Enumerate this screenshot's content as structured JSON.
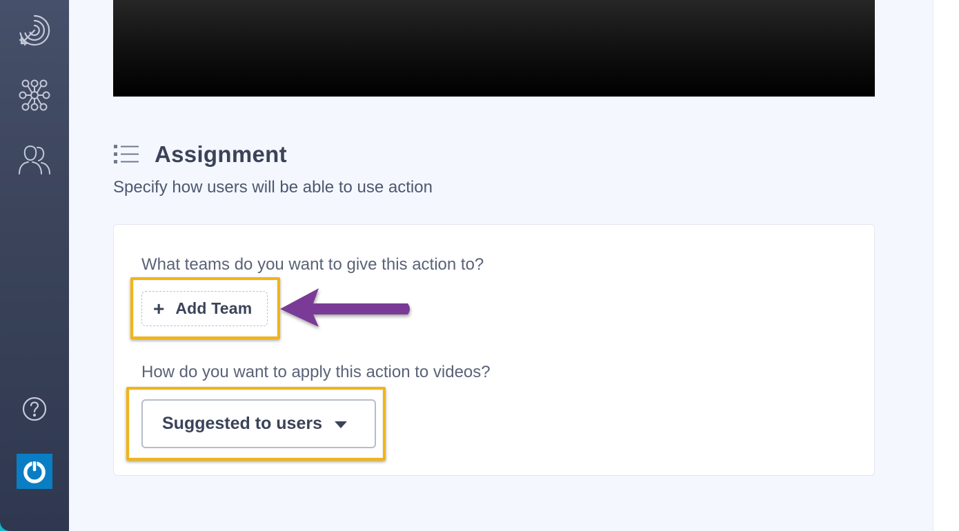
{
  "sidebar": {
    "items": [
      {
        "icon": "target-icon"
      },
      {
        "icon": "network-icon"
      },
      {
        "icon": "users-icon"
      }
    ],
    "help_icon": "help-icon",
    "power_icon": "power-icon"
  },
  "section": {
    "title": "Assignment",
    "subtitle": "Specify how users will be able to use action"
  },
  "card": {
    "teams_question": "What teams do you want to give this action to?",
    "add_team_label": "Add Team",
    "add_team_icon": "+",
    "videos_question": "How do you want to apply this action to videos?",
    "apply_select_value": "Suggested to users"
  },
  "colors": {
    "sidebar": "#3a4359",
    "highlight": "#f1b418",
    "arrow": "#7a3a96",
    "power": "#0a7ec4"
  }
}
